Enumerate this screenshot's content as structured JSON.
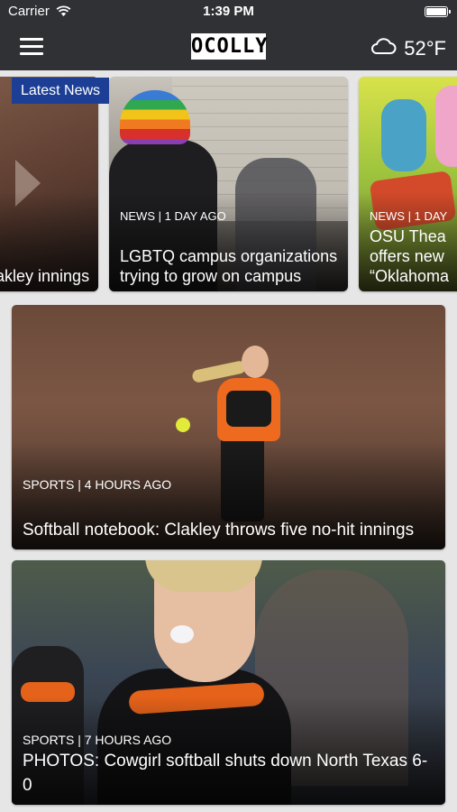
{
  "status_bar": {
    "carrier": "Carrier",
    "time": "1:39 PM",
    "icons": [
      "wifi-icon",
      "battery-icon"
    ]
  },
  "nav": {
    "logo": "OCOLLY",
    "temperature": "52°F",
    "icons": [
      "menu-icon",
      "cloud-icon"
    ]
  },
  "carousel": {
    "badge": "Latest News",
    "cards": [
      {
        "meta": "",
        "title": ": Clakley innings"
      },
      {
        "meta": "NEWS | 1 DAY AGO",
        "title": "LGBTQ campus organizations trying to grow on campus"
      },
      {
        "meta": "NEWS | 1 DAY",
        "title": "OSU Thea offers new “Oklahoma"
      }
    ]
  },
  "stories": [
    {
      "meta": "SPORTS | 4 HOURS AGO",
      "title": "Softball notebook: Clakley throws five no-hit innings"
    },
    {
      "meta": "SPORTS | 7 HOURS AGO",
      "title": "PHOTOS: Cowgirl softball shuts down North Texas 6-0"
    }
  ],
  "colors": {
    "bar_background": "#2f3134",
    "badge_background": "#1c3f95",
    "page_background": "#e6e6e6",
    "jersey_orange": "#ee6a1e"
  }
}
